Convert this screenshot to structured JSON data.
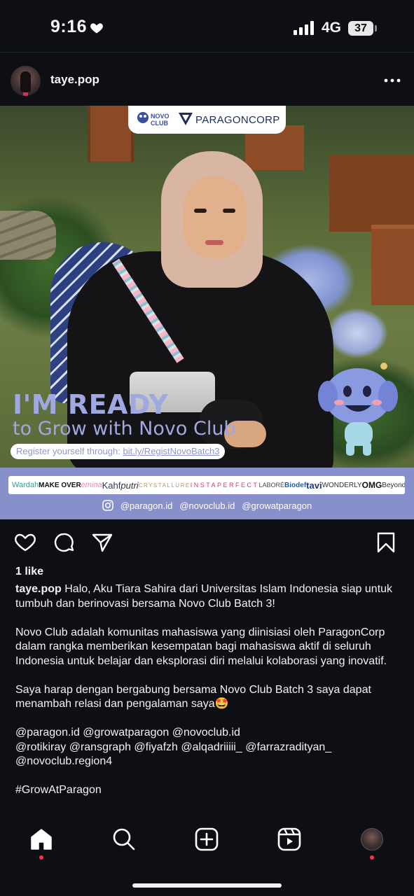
{
  "status_bar": {
    "time": "9:16",
    "network": "4G",
    "battery": "37"
  },
  "post": {
    "username": "taye.pop",
    "image": {
      "top_logo_text": "PARAGONCORP",
      "novo_logo_text": "NOVO CLUB",
      "headline_1": "I'M READY",
      "headline_2": "to Grow with Novo Club",
      "register_prefix": "Register yourself through: ",
      "register_link": "bit.ly/RegistNovoBatch3",
      "brands": [
        "Wardah",
        "MAKE OVER",
        "emina",
        "Kahf",
        "putri",
        "CRYSTALLURE",
        "INSTAPERFECT",
        "LABORÉ",
        "Biodef",
        "tavi",
        "WONDERLY",
        "OMG",
        "Beyondly"
      ],
      "socials": [
        "@paragon.id",
        "@novoclub.id",
        "@growatparagon"
      ]
    },
    "likes": "1 like",
    "caption": {
      "username": "taye.pop",
      "paragraph_1": "Halo, Aku Tiara Sahira dari Universitas Islam Indonesia siap untuk tumbuh dan berinovasi bersama Novo Club Batch 3!",
      "paragraph_2": "Novo Club adalah komunitas mahasiswa yang diinisiasi oleh ParagonCorp dalam rangka memberikan kesempatan bagi mahasiswa aktif di seluruh Indonesia untuk belajar dan eksplorasi diri melalui kolaborasi yang inovatif.",
      "paragraph_3": "Saya harap dengan bergabung bersama Novo Club Batch 3 saya dapat menambah relasi dan pengalaman saya🤩",
      "mentions_1": "@paragon.id @growatparagon @novoclub.id",
      "mentions_2": "@rotikiray @ransgraph @fiyafzh @alqadriiiii_ @farrazradityan_",
      "mentions_3": "@novoclub.region4",
      "hashtag": "#GrowAtParagon"
    }
  },
  "icons": {
    "status": [
      "heart-icon",
      "signal-icon"
    ],
    "actions": [
      "like-heart-icon",
      "comment-icon",
      "share-icon",
      "bookmark-icon"
    ],
    "nav": [
      "home-icon",
      "search-icon",
      "create-icon",
      "reels-icon",
      "profile-avatar"
    ]
  },
  "colors": {
    "background": "#0d0f14",
    "brand_band": "#8890cc",
    "notification_dot": "#ff2e4d"
  }
}
